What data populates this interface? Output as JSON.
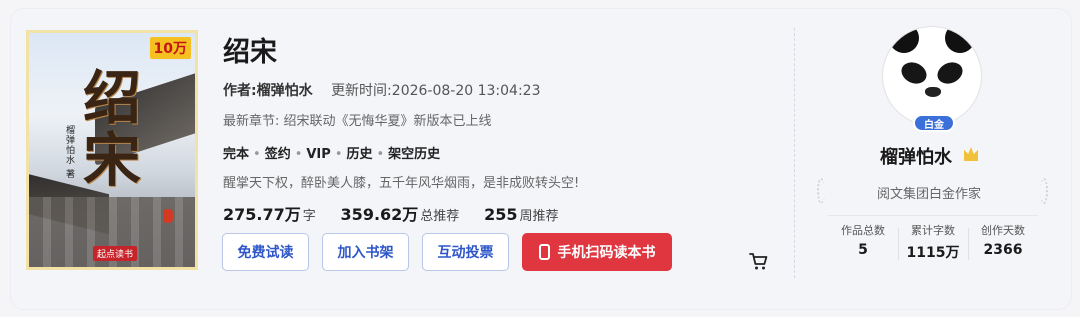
{
  "book": {
    "title": "绍宋",
    "cover": {
      "title_art": "绍宋",
      "author_art": "榴弹怕水 著",
      "badge": "10万",
      "publisher": "起点读书"
    },
    "author_label": "作者:",
    "author": "榴弹怕水",
    "update_label": "更新时间:",
    "update_time": "2026-08-20 13:04:23",
    "latest_label": "最新章节:",
    "latest_chapter": "绍宋联动《无悔华夏》新版本已上线",
    "tags": [
      "完本",
      "签约",
      "VIP",
      "历史",
      "架空历史"
    ],
    "intro": "醒掌天下权，醉卧美人膝，五千年风华烟雨，是非成败转头空!",
    "stats": {
      "words": "275.77万",
      "words_unit": "字",
      "total_rec": "359.62万",
      "total_rec_unit": "总推荐",
      "week_rec": "255",
      "week_rec_unit": "周推荐"
    },
    "buttons": {
      "trial": "免费试读",
      "shelf": "加入书架",
      "vote": "互动投票",
      "scan": "手机扫码读本书"
    }
  },
  "author_panel": {
    "badge": "白金",
    "name": "榴弹怕水",
    "role": "阅文集团白金作家",
    "stats": [
      {
        "label": "作品总数",
        "value": "5"
      },
      {
        "label": "累计字数",
        "value": "1115万"
      },
      {
        "label": "创作天数",
        "value": "2366"
      }
    ]
  },
  "colors": {
    "accent_blue": "#2e56c8",
    "primary_red": "#e0363f",
    "platinum_blue": "#3b6fd9"
  }
}
